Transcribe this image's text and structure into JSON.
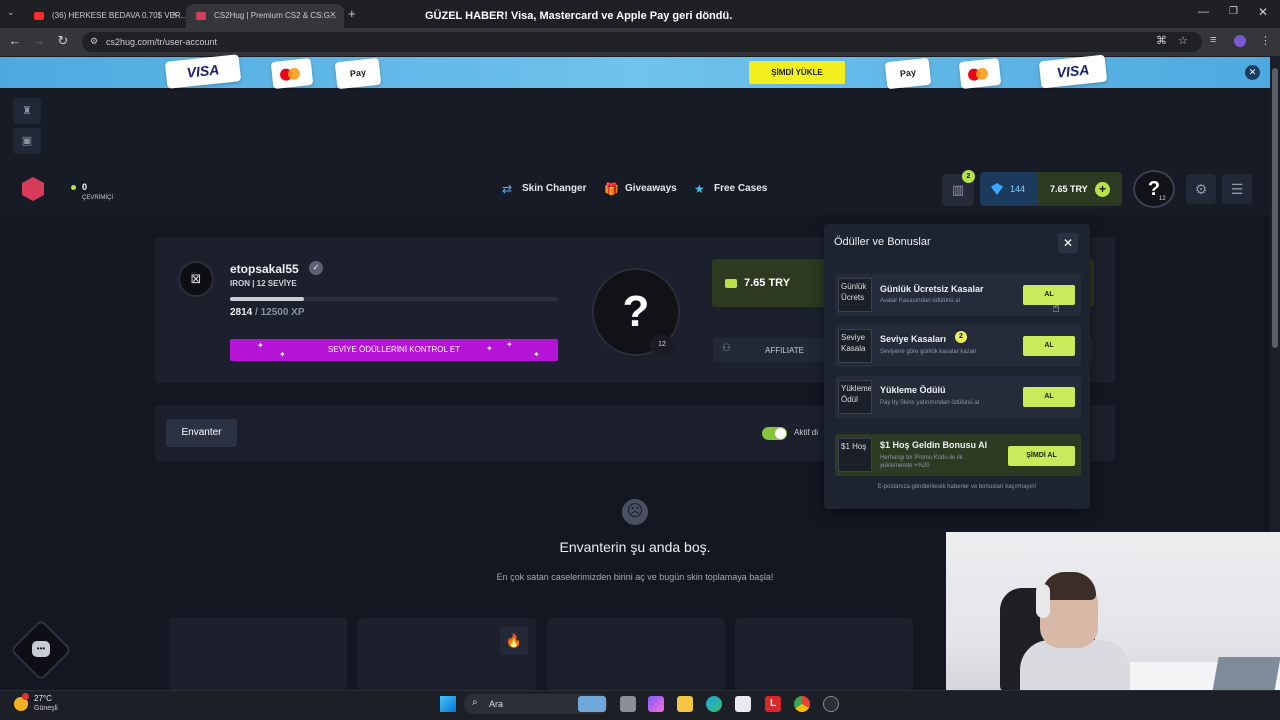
{
  "browser": {
    "tabs": [
      {
        "title": "(36) HERKESE BEDAVA 0.70$ VER..."
      },
      {
        "title": "CS2Hug | Premium CS2 & CS:G..."
      }
    ],
    "url": "cs2hug.com/tr/user-account",
    "new_tab": "+"
  },
  "promo": {
    "message": "GÜZEL HABER! Visa, Mastercard ve Apple Pay geri döndü.",
    "button": "ŞİMDİ YÜKLE",
    "visa": "VISA",
    "apple_pay": "Pay"
  },
  "header": {
    "online_count": "0",
    "online_label": "ÇEVRİMİÇİ",
    "nav": [
      {
        "label": "Skin Changer",
        "icon": "swap-icon"
      },
      {
        "label": "Giveaways",
        "icon": "gift-icon"
      },
      {
        "label": "Free Cases",
        "icon": "star-icon"
      }
    ],
    "gift_badge": "2",
    "gems": "144",
    "balance": "7.65 TRY",
    "avatar_symbol": "?",
    "avatar_level": "12"
  },
  "profile": {
    "username": "etopsakal55",
    "rank": "IRON | 12 SEVİYE",
    "xp_current": "2814",
    "xp_max": " / 12500 XP",
    "xp_progress": 0.225,
    "level_button": "SEVİYE ÖDÜLLERİNİ KONTROL ET",
    "big_avatar": "?",
    "big_avatar_level": "12",
    "balance": "7.65 TRY",
    "affiliate": "AFFILIATE"
  },
  "inventory": {
    "tab": "Envanter",
    "toggle_label": "Aktif di",
    "empty_title": "Envanterin şu anda boş.",
    "empty_subtitle": "En çok satan caselerimizden birini aç ve bugün skin toplamaya başla!"
  },
  "rewards": {
    "title": "Ödüller ve Bonuslar",
    "items": [
      {
        "thumb": "Günlük Ücrets",
        "title": "Günlük Ücretsiz Kasalar",
        "subtitle": "Avatar Kasasından ödülünü al",
        "button": "AL"
      },
      {
        "thumb": "Seviye Kasala",
        "title": "Seviye Kasaları",
        "subtitle": "Seviyene göre günlük kasalar kazan",
        "button": "AL",
        "badge": "2"
      },
      {
        "thumb": "Yükleme Ödül",
        "title": "Yükleme Ödülü",
        "subtitle": "Pay by Skins yatırımından ödülünü al",
        "button": "AL"
      },
      {
        "thumb": "$1 Hoş",
        "title": "$1 Hoş Geldin Bonusu Al",
        "subtitle": "Herhangi bir Promo Kodu ile ilk yüklemende +%20",
        "button": "ŞİMDİ AL"
      }
    ],
    "footer": "E-postanıza gönderilecek haberler ve bonusları kaçırmayın!"
  },
  "taskbar": {
    "temperature": "27°C",
    "condition": "Güneşli",
    "search": "Ara"
  },
  "colors": {
    "accent_lime": "#b7e24c",
    "level_button": "#b513d6",
    "promo_bg": "#6fc3ec",
    "page_bg": "#161b26"
  }
}
